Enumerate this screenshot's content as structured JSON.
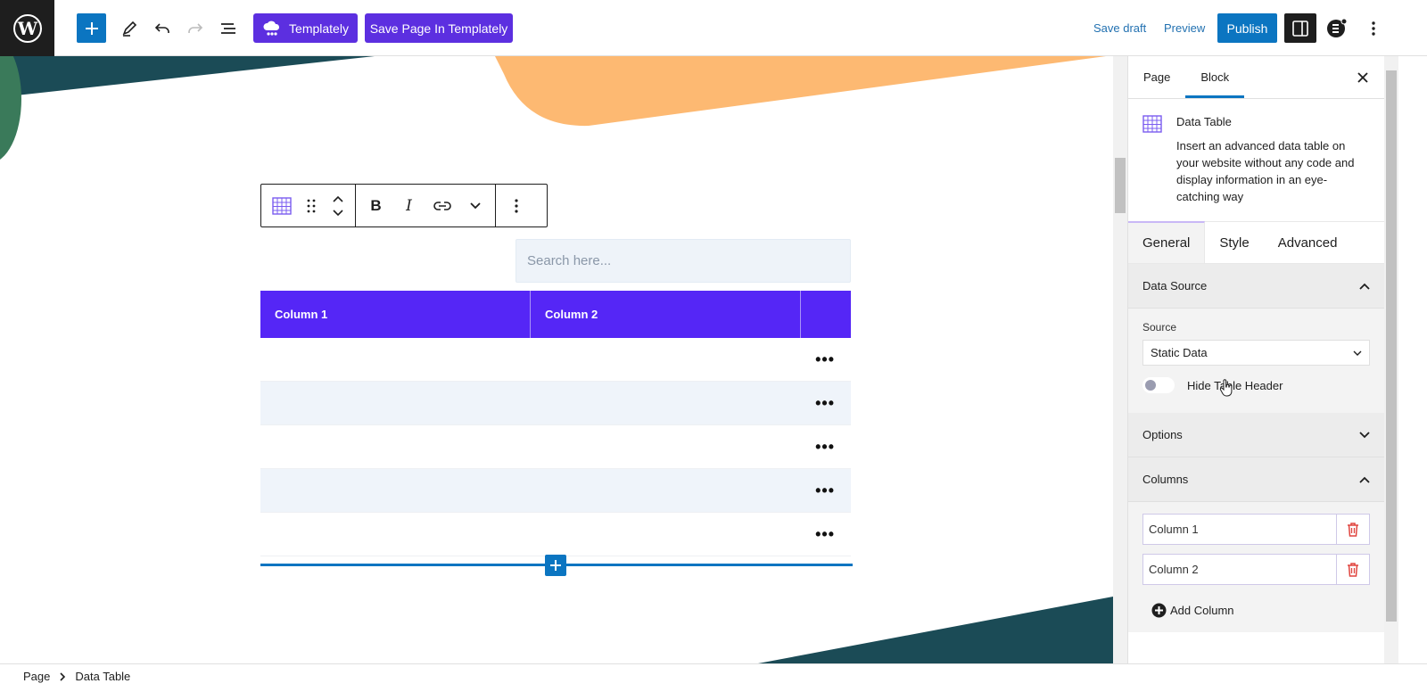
{
  "topbar": {
    "templately_label": "Templately",
    "save_templately_label": "Save Page In Templately",
    "save_draft_label": "Save draft",
    "preview_label": "Preview",
    "publish_label": "Publish"
  },
  "block_toolbar": {
    "bold": "B",
    "italic": "I"
  },
  "table": {
    "search_placeholder": "Search here...",
    "headers": [
      "Column 1",
      "Column 2",
      ""
    ],
    "row_count": 5
  },
  "sidebar": {
    "tabs": [
      "Page",
      "Block"
    ],
    "active_tab": "Block",
    "block": {
      "title": "Data Table",
      "description": "Insert an advanced data table on your website without any code and display information in an eye-catching way"
    },
    "panel_tabs": [
      "General",
      "Style",
      "Advanced"
    ],
    "active_panel_tab": "General",
    "data_source": {
      "title": "Data Source",
      "source_label": "Source",
      "source_value": "Static Data",
      "hide_header_label": "Hide Table Header"
    },
    "options_title": "Options",
    "columns": {
      "title": "Columns",
      "items": [
        "Column 1",
        "Column 2"
      ],
      "add_label": "Add Column"
    }
  },
  "footer": {
    "breadcrumb": [
      "Page",
      "Data Table"
    ]
  },
  "colors": {
    "accent": "#0b75c1",
    "templately": "#5c2fe0",
    "table_header": "#5526f6",
    "delete": "#e0443e"
  }
}
